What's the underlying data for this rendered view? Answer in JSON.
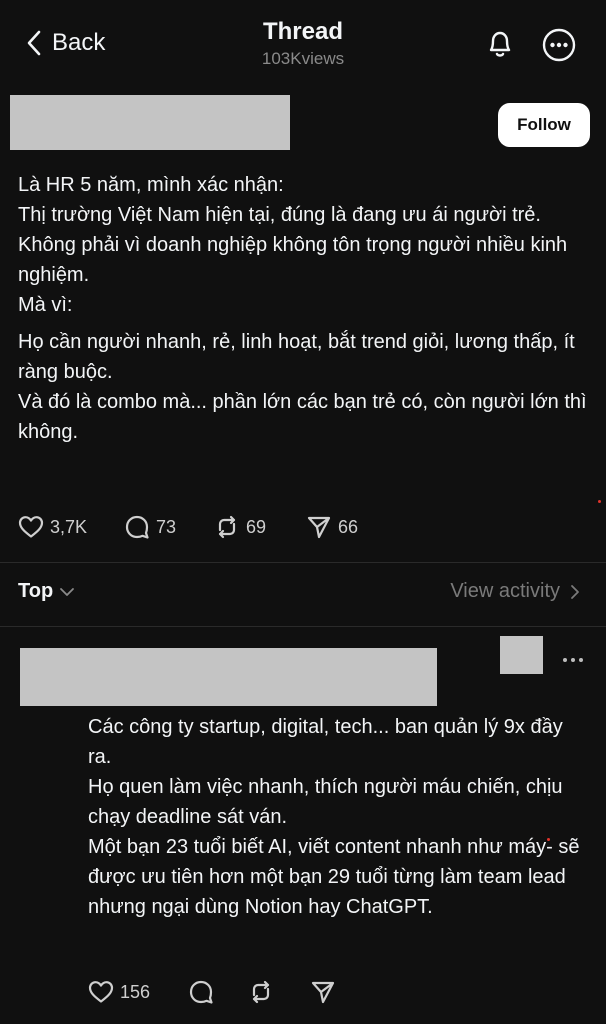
{
  "header": {
    "back_label": "Back",
    "title": "Thread",
    "views": "103Kviews"
  },
  "post": {
    "follow_label": "Follow",
    "lines": [
      "Là HR 5 năm, mình xác nhận:",
      "Thị trường Việt Nam hiện tại, đúng là đang ưu ái người trẻ.",
      "Không phải vì doanh nghiệp không tôn trọng người nhiều kinh nghiệm.",
      "Mà vì:",
      "Họ cần người nhanh, rẻ, linh hoạt, bắt trend giỏi, lương thấp, ít ràng buộc.",
      "Và đó là combo mà... phần lớn các bạn trẻ có, còn người lớn thì không."
    ],
    "likes": "3,7K",
    "replies": "73",
    "reposts": "69",
    "shares": "66"
  },
  "sort": {
    "label": "Top",
    "activity_label": "View activity"
  },
  "reply": {
    "lines": [
      "Các công ty startup, digital, tech... ban quản lý 9x đầy ra.",
      "Họ quen làm việc nhanh, thích người máu chiến, chịu chạy deadline sát ván.",
      "Một bạn 23 tuổi biết AI, viết content nhanh như máy- sẽ được ưu tiên hơn một bạn 29 tuổi từng làm team lead nhưng ngại dùng Notion hay ChatGPT."
    ],
    "likes": "156"
  },
  "icons": {
    "back": "chevron-left-icon",
    "notifications": "bell-icon",
    "menu": "more-horizontal-icon",
    "like": "heart-icon",
    "reply": "comment-icon",
    "repost": "repost-icon",
    "share": "send-icon"
  },
  "colors": {
    "background": "#101010",
    "text": "#f3f5f7",
    "muted": "#8a8a8a",
    "follow_bg": "#ffffff"
  }
}
